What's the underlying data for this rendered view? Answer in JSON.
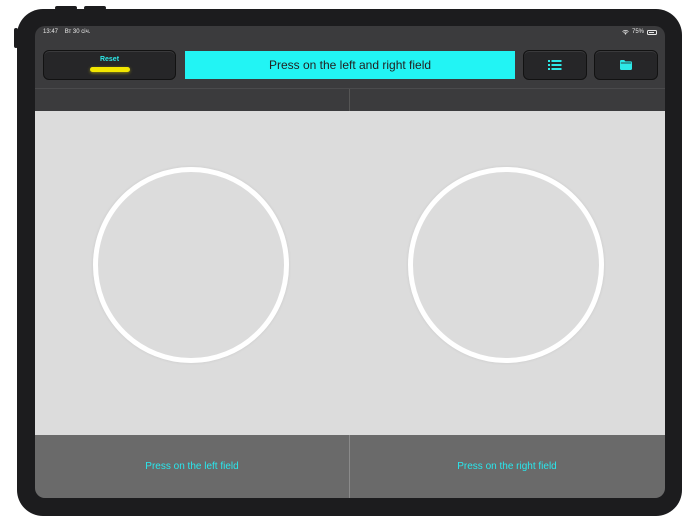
{
  "statusbar": {
    "time": "13:47",
    "date": "Вт 30 січ.",
    "battery_text": "75%",
    "battery_level": 0.75
  },
  "toolbar": {
    "reset_label": "Reset",
    "banner_text": "Press on the left and right field",
    "list_icon": "list-icon",
    "folder_icon": "folder-icon"
  },
  "fields": {
    "left_label": "Press on the left field",
    "right_label": "Press on the right field"
  },
  "colors": {
    "accent_cyan": "#22f4f4",
    "label_cyan": "#29e8ee",
    "reset_indicator": "#f2e600"
  }
}
